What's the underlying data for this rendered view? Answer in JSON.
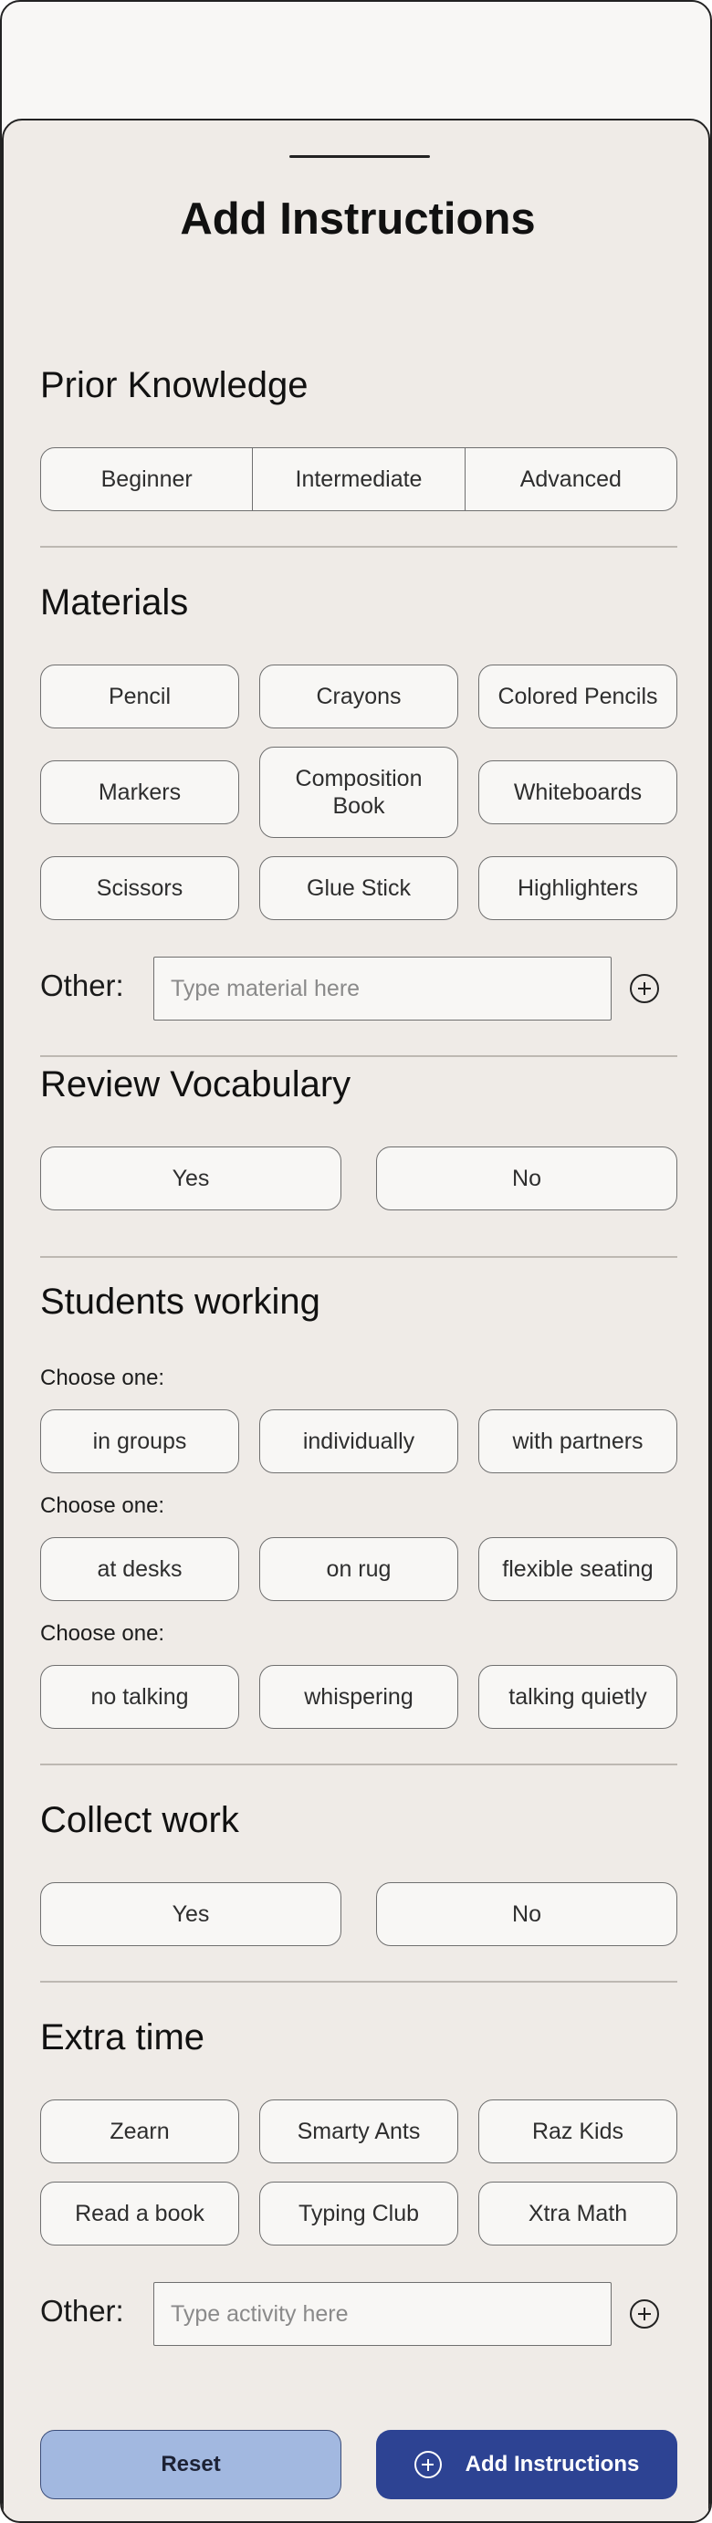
{
  "sheet": {
    "title": "Add Instructions"
  },
  "prior_knowledge": {
    "title": "Prior Knowledge",
    "options": [
      "Beginner",
      "Intermediate",
      "Advanced"
    ]
  },
  "materials": {
    "title": "Materials",
    "options": [
      "Pencil",
      "Crayons",
      "Colored Pencils",
      "Markers",
      "Composition Book",
      "Whiteboards",
      "Scissors",
      "Glue Stick",
      "Highlighters"
    ],
    "other_label": "Other:",
    "other_placeholder": "Type material here"
  },
  "review_vocabulary": {
    "title": "Review Vocabulary",
    "options": [
      "Yes",
      "No"
    ]
  },
  "students_working": {
    "title": "Students working",
    "groups": [
      {
        "label": "Choose one:",
        "options": [
          "in groups",
          "individually",
          "with partners"
        ]
      },
      {
        "label": "Choose one:",
        "options": [
          "at desks",
          "on rug",
          "flexible seating"
        ]
      },
      {
        "label": "Choose one:",
        "options": [
          "no talking",
          "whispering",
          "talking quietly"
        ]
      }
    ]
  },
  "collect_work": {
    "title": "Collect work",
    "options": [
      "Yes",
      "No"
    ]
  },
  "extra_time": {
    "title": "Extra time",
    "options": [
      "Zearn",
      "Smarty Ants",
      "Raz Kids",
      "Read a book",
      "Typing Club",
      "Xtra Math"
    ],
    "other_label": "Other:",
    "other_placeholder": "Type activity here"
  },
  "footer": {
    "reset_label": "Reset",
    "add_label": "Add Instructions"
  },
  "colors": {
    "sheet_bg": "#efebe7",
    "chip_bg": "#f8f7f5",
    "primary": "#2d4393",
    "secondary": "#a2b8e0"
  },
  "icons": [
    "add-circle-icon"
  ]
}
